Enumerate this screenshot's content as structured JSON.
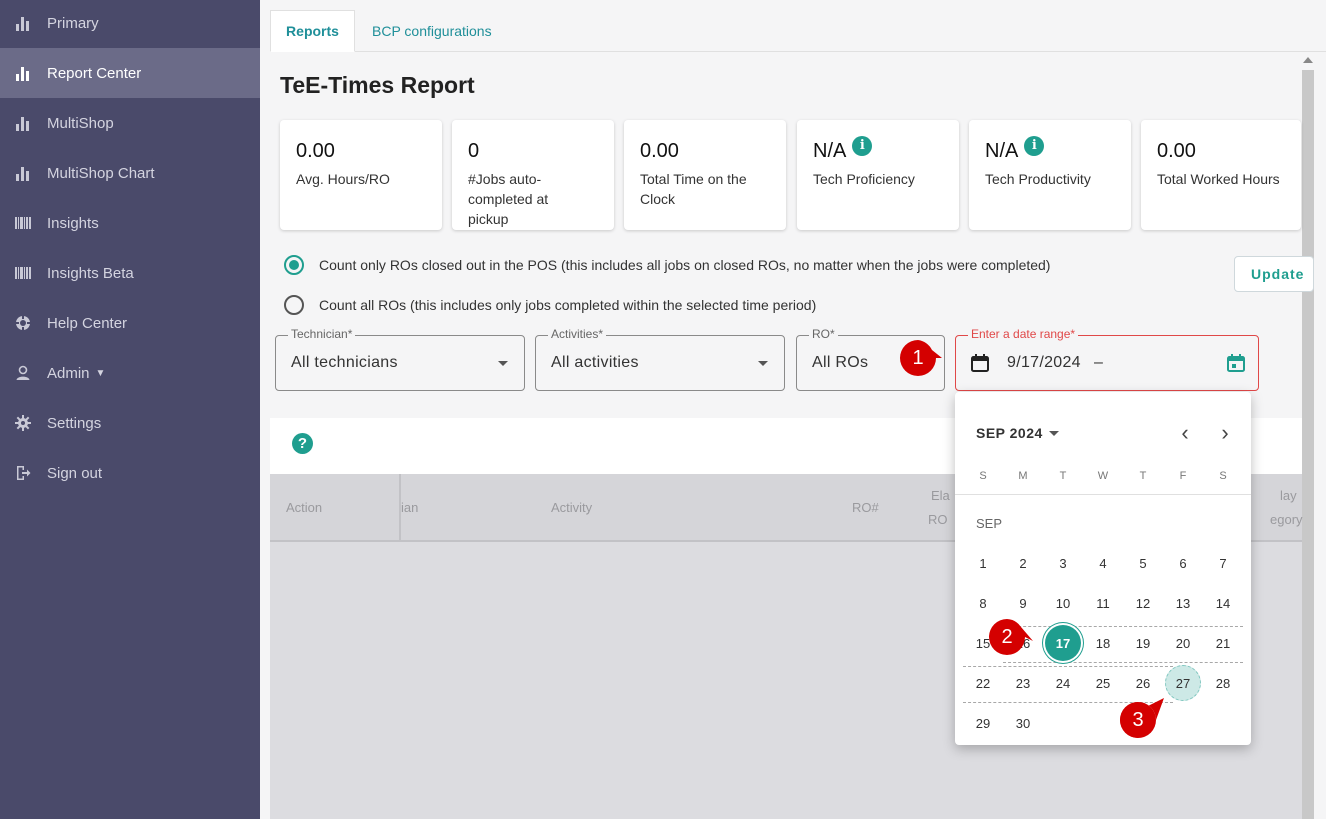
{
  "sidebar": {
    "items": [
      {
        "label": "Primary",
        "icon": "bar-chart-icon"
      },
      {
        "label": "Report Center",
        "icon": "bar-chart-icon",
        "active": true
      },
      {
        "label": "MultiShop",
        "icon": "bar-chart-icon"
      },
      {
        "label": "MultiShop Chart",
        "icon": "bar-chart-icon"
      },
      {
        "label": "Insights",
        "icon": "barcode-icon"
      },
      {
        "label": "Insights Beta",
        "icon": "barcode-icon"
      },
      {
        "label": "Help Center",
        "icon": "lifebuoy-icon"
      },
      {
        "label": "Admin",
        "icon": "user-icon"
      },
      {
        "label": "Settings",
        "icon": "gear-icon"
      },
      {
        "label": "Sign out",
        "icon": "sign-out-icon"
      }
    ]
  },
  "tabs": [
    {
      "label": "Reports",
      "active": true
    },
    {
      "label": "BCP configurations"
    }
  ],
  "page": {
    "title": "TeE-Times Report"
  },
  "metrics": [
    {
      "value": "0.00",
      "label": "Avg. Hours/RO"
    },
    {
      "value": "0",
      "label": "#Jobs auto-completed at pickup"
    },
    {
      "value": "0.00",
      "label": "Total Time on the Clock"
    },
    {
      "value": "N/A",
      "label": "Tech Proficiency",
      "info": "i"
    },
    {
      "value": "N/A",
      "label": "Tech Productivity",
      "info": "i"
    },
    {
      "value": "0.00",
      "label": "Total Worked Hours"
    }
  ],
  "options": {
    "closed_ros": "Count only ROs closed out in the POS (this includes all jobs on closed ROs, no matter when the jobs were completed)",
    "all_ros": "Count all ROs (this includes only jobs completed within the selected time period)",
    "update_label": "Update"
  },
  "filters": {
    "technician": {
      "label": "Technician*",
      "value": "All technicians"
    },
    "activities": {
      "label": "Activities*",
      "value": "All activities"
    },
    "ro": {
      "label": "RO*",
      "value": "All ROs"
    },
    "date": {
      "label": "Enter a date range*",
      "start": "9/17/2024",
      "separator": "–"
    }
  },
  "results": {
    "help": "?",
    "columns": [
      "Action",
      "ian",
      "Activity",
      "RO#",
      "Ela",
      "RO",
      "lay",
      "egory"
    ]
  },
  "calendar": {
    "month_label": "SEP 2024",
    "section_label": "SEP",
    "weekdays": [
      "S",
      "M",
      "T",
      "W",
      "T",
      "F",
      "S"
    ],
    "prev": "‹",
    "next": "›",
    "selected_start": 17,
    "selected_end": 27
  },
  "annotations": [
    "1",
    "2",
    "3"
  ],
  "colors": {
    "accent": "#1f9e8f",
    "sidebar": "#4a4a6a",
    "error": "#e04848",
    "marker": "#d40000"
  }
}
